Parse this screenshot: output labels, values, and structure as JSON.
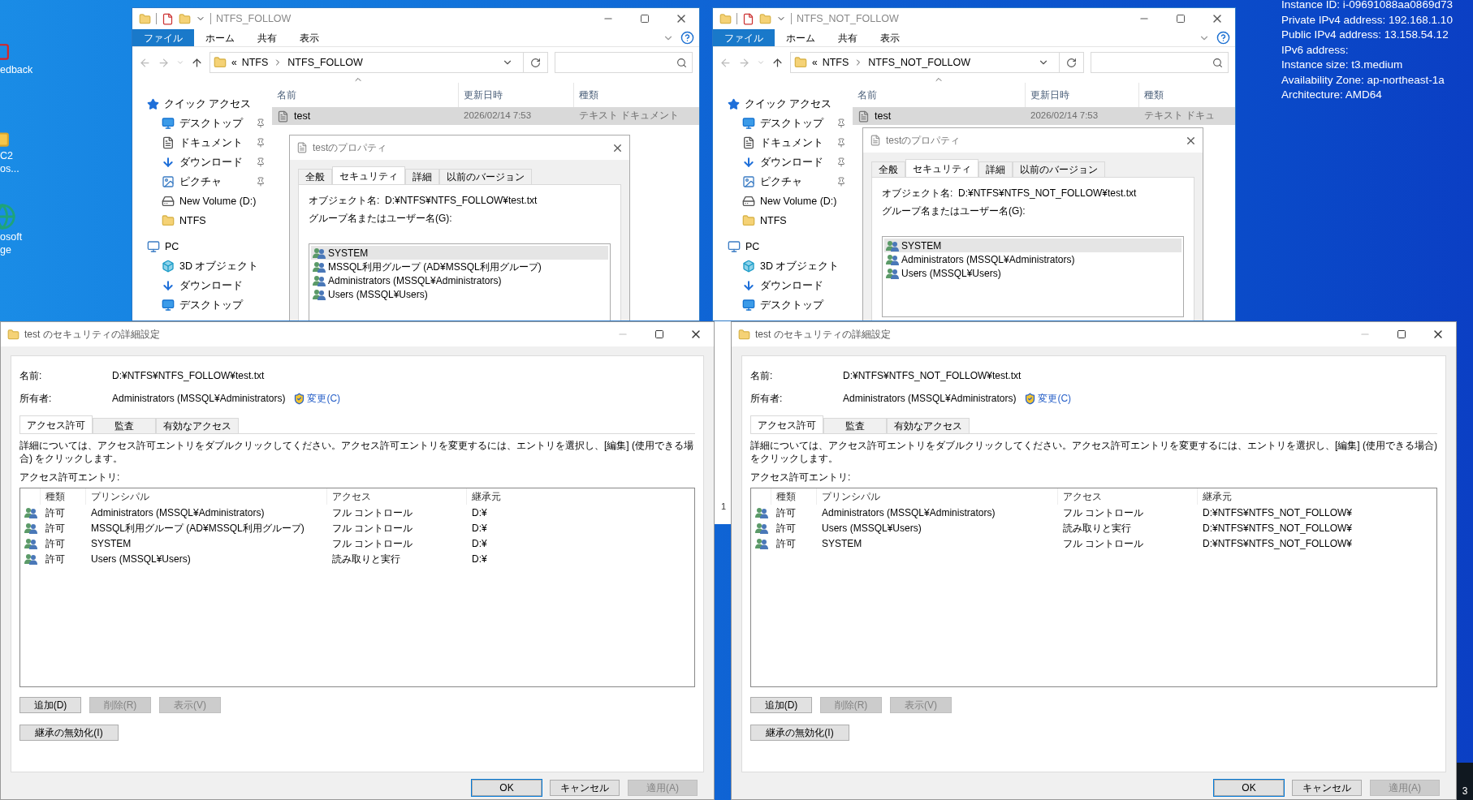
{
  "desktop": {
    "icons": [
      {
        "kind": "feedback",
        "lines": [
          "edback"
        ]
      },
      {
        "kind": "folder",
        "lines": [
          "C2",
          "os..."
        ]
      },
      {
        "kind": "browser",
        "lines": [
          "osoft",
          "ge"
        ]
      }
    ],
    "instance_info": [
      "Instance ID: i-09691088aa0869d73",
      "Private IPv4 address: 192.168.1.10",
      "Public IPv4 address: 13.158.54.12",
      "IPv6 address:",
      "Instance size: t3.medium",
      "Availability Zone: ap-northeast-1a",
      "Architecture: AMD64"
    ],
    "window_edge_text": "1",
    "taskbar_text": "3"
  },
  "explorers": [
    {
      "title": "NTFS_FOLLOW",
      "ribbon_tabs": [
        {
          "label": "ファイル",
          "selected": true
        },
        {
          "label": "ホーム",
          "selected": false
        },
        {
          "label": "共有",
          "selected": false
        },
        {
          "label": "表示",
          "selected": false
        }
      ],
      "breadcrumb_overflow": "«",
      "breadcrumb": [
        "NTFS",
        "NTFS_FOLLOW"
      ],
      "nav": [
        {
          "label": "クイック アクセス",
          "kind": "quick",
          "pinned": false,
          "children": [
            {
              "label": "デスクトップ",
              "kind": "desktop",
              "pinned": true
            },
            {
              "label": "ドキュメント",
              "kind": "documents",
              "pinned": true
            },
            {
              "label": "ダウンロード",
              "kind": "downloads",
              "pinned": true
            },
            {
              "label": "ピクチャ",
              "kind": "pictures",
              "pinned": true
            },
            {
              "label": "New Volume (D:)",
              "kind": "drive",
              "pinned": false
            },
            {
              "label": "NTFS",
              "kind": "folder",
              "pinned": false
            }
          ]
        },
        {
          "label": "PC",
          "kind": "pc",
          "pinned": false,
          "children": [
            {
              "label": "3D オブジェクト",
              "kind": "objects3d",
              "pinned": false
            },
            {
              "label": "ダウンロード",
              "kind": "downloads",
              "pinned": false
            },
            {
              "label": "デスクトップ",
              "kind": "desktop",
              "pinned": false
            }
          ]
        }
      ],
      "columns": [
        "名前",
        "更新日時",
        "種類"
      ],
      "files": [
        {
          "name": "test",
          "date": "2026/02/14 7:53",
          "type": "テキスト ドキュメント",
          "selected": true
        }
      ],
      "properties": {
        "title": "testのプロパティ",
        "tabs": [
          {
            "label": "全般",
            "selected": false
          },
          {
            "label": "セキュリティ",
            "selected": true
          },
          {
            "label": "詳細",
            "selected": false
          },
          {
            "label": "以前のバージョン",
            "selected": false
          }
        ],
        "object_label": "オブジェクト名:",
        "object_value": "D:¥NTFS¥NTFS_FOLLOW¥test.txt",
        "group_label": "グループ名またはユーザー名(G):",
        "principals": [
          {
            "name": "SYSTEM",
            "selected": true
          },
          {
            "name": "MSSQL利用グループ (AD¥MSSQL利用グループ)",
            "selected": false
          },
          {
            "name": "Administrators (MSSQL¥Administrators)",
            "selected": false
          },
          {
            "name": "Users (MSSQL¥Users)",
            "selected": false
          }
        ]
      }
    },
    {
      "title": "NTFS_NOT_FOLLOW",
      "ribbon_tabs": [
        {
          "label": "ファイル",
          "selected": true
        },
        {
          "label": "ホーム",
          "selected": false
        },
        {
          "label": "共有",
          "selected": false
        },
        {
          "label": "表示",
          "selected": false
        }
      ],
      "breadcrumb_overflow": "«",
      "breadcrumb": [
        "NTFS",
        "NTFS_NOT_FOLLOW"
      ],
      "nav": [
        {
          "label": "クイック アクセス",
          "kind": "quick",
          "pinned": false,
          "children": [
            {
              "label": "デスクトップ",
              "kind": "desktop",
              "pinned": true
            },
            {
              "label": "ドキュメント",
              "kind": "documents",
              "pinned": true
            },
            {
              "label": "ダウンロード",
              "kind": "downloads",
              "pinned": true
            },
            {
              "label": "ピクチャ",
              "kind": "pictures",
              "pinned": true
            },
            {
              "label": "New Volume (D:)",
              "kind": "drive",
              "pinned": false
            },
            {
              "label": "NTFS",
              "kind": "folder",
              "pinned": false
            }
          ]
        },
        {
          "label": "PC",
          "kind": "pc",
          "pinned": false,
          "children": [
            {
              "label": "3D オブジェクト",
              "kind": "objects3d",
              "pinned": false
            },
            {
              "label": "ダウンロード",
              "kind": "downloads",
              "pinned": false
            },
            {
              "label": "デスクトップ",
              "kind": "desktop",
              "pinned": false
            }
          ]
        }
      ],
      "columns": [
        "名前",
        "更新日時",
        "種類"
      ],
      "files": [
        {
          "name": "test",
          "date": "2026/02/14 7:53",
          "type": "テキスト ドキュ",
          "selected": true
        }
      ],
      "properties": {
        "title": "testのプロパティ",
        "tabs": [
          {
            "label": "全般",
            "selected": false
          },
          {
            "label": "セキュリティ",
            "selected": true
          },
          {
            "label": "詳細",
            "selected": false
          },
          {
            "label": "以前のバージョン",
            "selected": false
          }
        ],
        "object_label": "オブジェクト名:",
        "object_value": "D:¥NTFS¥NTFS_NOT_FOLLOW¥test.txt",
        "group_label": "グループ名またはユーザー名(G):",
        "principals": [
          {
            "name": "SYSTEM",
            "selected": true
          },
          {
            "name": "Administrators (MSSQL¥Administrators)",
            "selected": false
          },
          {
            "name": "Users (MSSQL¥Users)",
            "selected": false
          }
        ]
      }
    }
  ],
  "security_dialogs": [
    {
      "title": "test のセキュリティの詳細設定",
      "name_label": "名前:",
      "name_value": "D:¥NTFS¥NTFS_FOLLOW¥test.txt",
      "owner_label": "所有者:",
      "owner_value": "Administrators (MSSQL¥Administrators)",
      "change_link": "変更(C)",
      "tabs": [
        {
          "label": "アクセス許可",
          "selected": true
        },
        {
          "label": "監査",
          "selected": false
        },
        {
          "label": "有効なアクセス",
          "selected": false
        }
      ],
      "description": "詳細については、アクセス許可エントリをダブルクリックしてください。アクセス許可エントリを変更するには、エントリを選択し、[編集] (使用できる場合) をクリックします。",
      "entries_label": "アクセス許可エントリ:",
      "columns": [
        "種類",
        "プリンシパル",
        "アクセス",
        "継承元"
      ],
      "entries": [
        {
          "type": "許可",
          "principal": "Administrators (MSSQL¥Administrators)",
          "access": "フル コントロール",
          "inherited_from": "D:¥"
        },
        {
          "type": "許可",
          "principal": "MSSQL利用グループ (AD¥MSSQL利用グループ)",
          "access": "フル コントロール",
          "inherited_from": "D:¥"
        },
        {
          "type": "許可",
          "principal": "SYSTEM",
          "access": "フル コントロール",
          "inherited_from": "D:¥"
        },
        {
          "type": "許可",
          "principal": "Users (MSSQL¥Users)",
          "access": "読み取りと実行",
          "inherited_from": "D:¥"
        }
      ],
      "buttons": [
        {
          "label": "追加(D)",
          "disabled": false
        },
        {
          "label": "削除(R)",
          "disabled": true
        },
        {
          "label": "表示(V)",
          "disabled": true
        }
      ],
      "inheritance_button": "継承の無効化(I)",
      "dialog_buttons": [
        {
          "label": "OK",
          "disabled": false,
          "default": true
        },
        {
          "label": "キャンセル",
          "disabled": false,
          "default": false
        },
        {
          "label": "適用(A)",
          "disabled": true,
          "default": false
        }
      ]
    },
    {
      "title": "test のセキュリティの詳細設定",
      "name_label": "名前:",
      "name_value": "D:¥NTFS¥NTFS_NOT_FOLLOW¥test.txt",
      "owner_label": "所有者:",
      "owner_value": "Administrators (MSSQL¥Administrators)",
      "change_link": "変更(C)",
      "tabs": [
        {
          "label": "アクセス許可",
          "selected": true
        },
        {
          "label": "監査",
          "selected": false
        },
        {
          "label": "有効なアクセス",
          "selected": false
        }
      ],
      "description": "詳細については、アクセス許可エントリをダブルクリックしてください。アクセス許可エントリを変更するには、エントリを選択し、[編集] (使用できる場合) をクリックします。",
      "entries_label": "アクセス許可エントリ:",
      "columns": [
        "種類",
        "プリンシパル",
        "アクセス",
        "継承元"
      ],
      "entries": [
        {
          "type": "許可",
          "principal": "Administrators (MSSQL¥Administrators)",
          "access": "フル コントロール",
          "inherited_from": "D:¥NTFS¥NTFS_NOT_FOLLOW¥"
        },
        {
          "type": "許可",
          "principal": "Users (MSSQL¥Users)",
          "access": "読み取りと実行",
          "inherited_from": "D:¥NTFS¥NTFS_NOT_FOLLOW¥"
        },
        {
          "type": "許可",
          "principal": "SYSTEM",
          "access": "フル コントロール",
          "inherited_from": "D:¥NTFS¥NTFS_NOT_FOLLOW¥"
        }
      ],
      "buttons": [
        {
          "label": "追加(D)",
          "disabled": false
        },
        {
          "label": "削除(R)",
          "disabled": true
        },
        {
          "label": "表示(V)",
          "disabled": true
        }
      ],
      "inheritance_button": "継承の無効化(I)",
      "dialog_buttons": [
        {
          "label": "OK",
          "disabled": false,
          "default": true
        },
        {
          "label": "キャンセル",
          "disabled": false,
          "default": false
        },
        {
          "label": "適用(A)",
          "disabled": true,
          "default": false
        }
      ]
    }
  ]
}
